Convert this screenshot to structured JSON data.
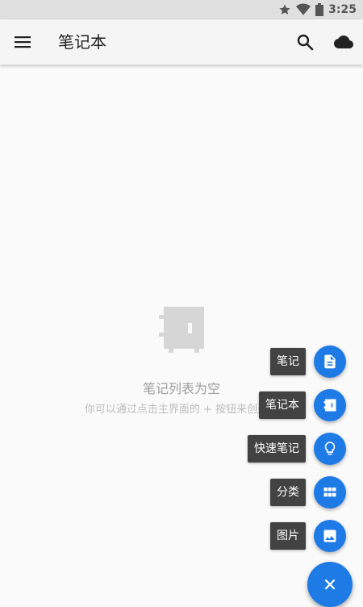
{
  "status_bar": {
    "time": "3:25",
    "icons": [
      "star-icon",
      "wifi-icon",
      "battery-icon"
    ]
  },
  "app_bar": {
    "title": "笔记本",
    "icons": [
      "menu-icon",
      "search-icon",
      "cloud-icon"
    ]
  },
  "empty_state": {
    "icon": "notebook-icon",
    "title": "笔记列表为空",
    "subtitle": "你可以通过点击主界面的 + 按钮来创建一"
  },
  "fab_menu": {
    "items": [
      {
        "label": "笔记",
        "icon": "document-icon"
      },
      {
        "label": "笔记本",
        "icon": "notebook-icon"
      },
      {
        "label": "快速笔记",
        "icon": "lightbulb-icon"
      },
      {
        "label": "分类",
        "icon": "grid-icon"
      },
      {
        "label": "图片",
        "icon": "image-icon"
      }
    ],
    "main_icon": "close-icon"
  },
  "colors": {
    "accent": "#1e7be6",
    "label_bg": "#424242",
    "app_bar_bg": "#f5f5f5",
    "status_bar_bg": "#e0e0e0"
  }
}
